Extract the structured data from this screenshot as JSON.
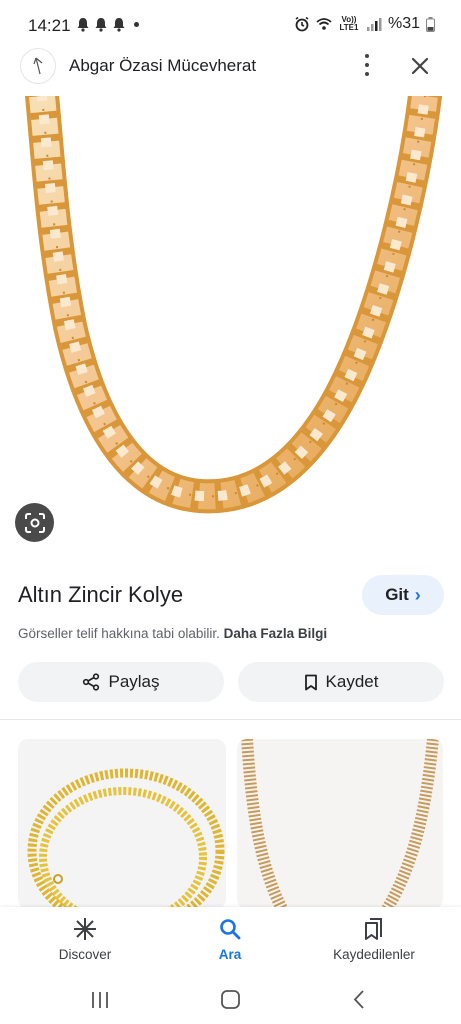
{
  "status_bar": {
    "time": "14:21",
    "battery": "%31",
    "lte_label": "Vo)) LTE1",
    "icons": [
      "bell-icon",
      "bell-icon",
      "bell-icon",
      "dot-icon",
      "alarm-icon",
      "wifi-icon",
      "signal-icon",
      "battery-icon"
    ]
  },
  "header": {
    "site_name": "Abgar Özasi Mücevherat",
    "icons": [
      "site-logo-icon",
      "more-vert-icon",
      "close-icon"
    ]
  },
  "product": {
    "title": "Altın Zincir Kolye",
    "go_button": "Git",
    "copyright_text": "Görseller telif hakkına tabi olabilir.",
    "more_info": "Daha Fazla Bilgi",
    "share_button": "Paylaş",
    "save_button": "Kaydet"
  },
  "bottom_nav": {
    "items": [
      {
        "label": "Discover",
        "icon": "asterisk-icon"
      },
      {
        "label": "Ara",
        "icon": "search-icon",
        "active": true
      },
      {
        "label": "Kaydedilenler",
        "icon": "bookmarks-icon"
      }
    ]
  },
  "system_nav": {
    "icons": [
      "recent-apps-icon",
      "home-icon",
      "back-icon"
    ]
  },
  "colors": {
    "accent": "#1a73e8",
    "gold": "#e2ab4a",
    "gold_light": "#f4d7a8",
    "go_bg": "#e9f1fc"
  }
}
